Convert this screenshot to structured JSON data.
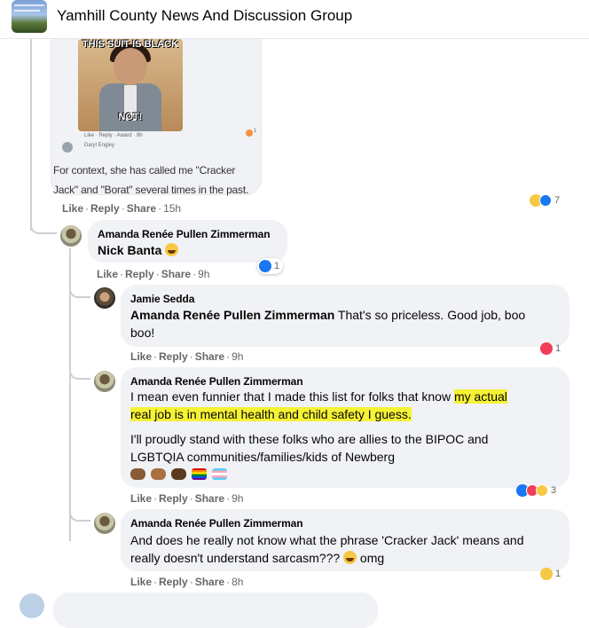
{
  "header": {
    "group_name": "Yamhill County News And Discussion Group"
  },
  "top_comment": {
    "meme_caption_top": "THIS SUIT IS BLACK",
    "meme_caption_bottom": "NOT!",
    "meme_meta": "Like · Reply · Award · 9h",
    "meme_author": "Daryl Engley",
    "meme_reaction_count": "1",
    "context_text": "For context, she has called me \"Cracker Jack\" and \"Borat\" several times in the past.",
    "actions": {
      "like": "Like",
      "reply": "Reply",
      "share": "Share",
      "time": "15h"
    },
    "reaction_count": "7"
  },
  "comments": [
    {
      "author": "Amanda Renée Pullen Zimmerman",
      "mention": "Nick Banta",
      "text": "",
      "actions": {
        "like": "Like",
        "reply": "Reply",
        "share": "Share",
        "time": "9h"
      },
      "reaction_count": "1"
    },
    {
      "author": "Jamie Sedda",
      "mention": "Amanda Renée Pullen Zimmerman",
      "text_line1": " That's so priceless. Good job, boo",
      "text_line2": "boo!",
      "actions": {
        "like": "Like",
        "reply": "Reply",
        "share": "Share",
        "time": "9h"
      },
      "reaction_count": "1"
    },
    {
      "author": "Amanda Renée Pullen Zimmerman",
      "text_plain_1": "I mean even funnier that I made this list for folks that know ",
      "text_hl_1": "my actual",
      "text_hl_2": "real job is in mental health and child safety I guess.",
      "paragraph2": "I'll proudly stand with these folks who are allies to the BIPOC and LGBTQIA communities/families/kids of Newberg",
      "actions": {
        "like": "Like",
        "reply": "Reply",
        "share": "Share",
        "time": "9h"
      },
      "reaction_count": "3"
    },
    {
      "author": "Amanda Renée Pullen Zimmerman",
      "text_line1": "And does he really not know what the phrase 'Cracker Jack' means and",
      "text_line2": "really doesn't understand sarcasm???",
      "text_tail": " omg",
      "actions": {
        "like": "Like",
        "reply": "Reply",
        "share": "Share",
        "time": "8h"
      },
      "reaction_count": "1"
    }
  ],
  "colors": {
    "bubble": "#f0f2f5",
    "highlight": "#f6f235",
    "like_blue": "#1877f2",
    "love_red": "#f33e58",
    "haha_yellow": "#f7c844"
  },
  "icons": [
    "group-avatar",
    "like-reaction-icon",
    "love-reaction-icon",
    "haha-reaction-icon",
    "laughing-emoji",
    "fist-emoji",
    "rainbow-flag-emoji",
    "transgender-flag-emoji"
  ]
}
